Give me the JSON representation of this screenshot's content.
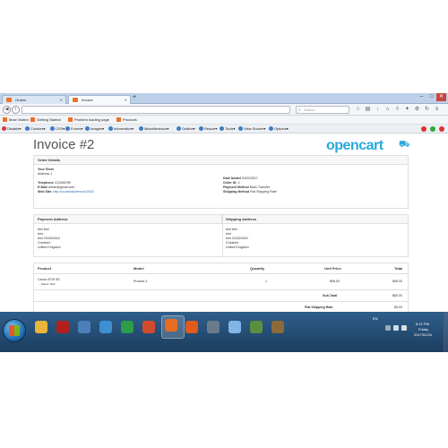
{
  "browser": {
    "tabs": [
      {
        "label": "Orders"
      },
      {
        "label": "Invoice"
      }
    ],
    "new_tab_symbol": "+",
    "window_controls": [
      "–",
      "□",
      "✕"
    ],
    "search_placeholder": "Search",
    "bookmarks": [
      "Most Visited",
      "Getting Started",
      "Problem loading page",
      "Products"
    ],
    "dev_toolbar": [
      "Disable▾",
      "Cookies▾",
      "CSS▾",
      "Forms▾",
      "Images▾",
      "Information▾",
      "Miscellaneous▾",
      "Outline▾",
      "Resize▾",
      "Tools▾",
      "View Source▾",
      "Options▾"
    ]
  },
  "page": {
    "title": "Invoice #2",
    "logo_text": "opencart",
    "order_details": {
      "heading": "Order Details",
      "store_name": "Your Store",
      "store_address": "Address 1",
      "telephone_label": "Telephone",
      "telephone": "123456789",
      "email_label": "E-Mail",
      "email": "admin@gmail.com",
      "website_label": "Web Site:",
      "website": "http://localhost/demoxx2002/",
      "date_added_label": "Date Added",
      "date_added": "03/02/2017",
      "order_id_label": "Order ID:",
      "order_id": "2",
      "payment_method_label": "Payment Method",
      "payment_method": "Bank Transfer",
      "shipping_method_label": "Shipping Method",
      "shipping_method": "Flat Shipping Rate"
    },
    "payment_address": {
      "heading": "Payment Address",
      "lines": [
        "test test",
        "test",
        "test 234324324",
        "Cheshire",
        "United Kingdom"
      ]
    },
    "shipping_address": {
      "heading": "Shipping Address",
      "lines": [
        "test test",
        "test",
        "test 234324324",
        "Cheshire",
        "United Kingdom"
      ]
    },
    "products": {
      "columns": [
        "Product",
        "Model",
        "Quantity",
        "Unit Price",
        "Total"
      ],
      "rows": [
        {
          "product": "Canon EOS 5D",
          "option": "- Select: Red",
          "model": "Product 3",
          "quantity": "1",
          "unit_price": "$98.00",
          "total": "$98.00"
        }
      ],
      "totals": [
        {
          "label": "Sub-Total",
          "value": "$80.00"
        },
        {
          "label": "Flat Shipping Rate",
          "value": "$5.00"
        }
      ]
    }
  },
  "taskbar": {
    "apps": [
      {
        "name": "explorer",
        "color": "#e9b53a"
      },
      {
        "name": "filezilla",
        "color": "#b2201c"
      },
      {
        "name": "notepad",
        "color": "#4b7fb8"
      },
      {
        "name": "paint",
        "color": "#3d8fd1"
      },
      {
        "name": "chrome",
        "color": "#2f9c4a"
      },
      {
        "name": "browser-2",
        "color": "#d24b2f"
      },
      {
        "name": "firefox",
        "color": "#e66d1f"
      },
      {
        "name": "xampp",
        "color": "#e05a1e"
      },
      {
        "name": "app-9",
        "color": "#6b7b8b"
      },
      {
        "name": "weather",
        "color": "#7fb6e6"
      },
      {
        "name": "app-11",
        "color": "#5a8f3f"
      },
      {
        "name": "app-12",
        "color": "#8e6a3a"
      }
    ],
    "language": "EN",
    "time": "8:12 PM",
    "day": "Friday",
    "date": "2017/02/24",
    "accent": "#1f6eb2"
  }
}
